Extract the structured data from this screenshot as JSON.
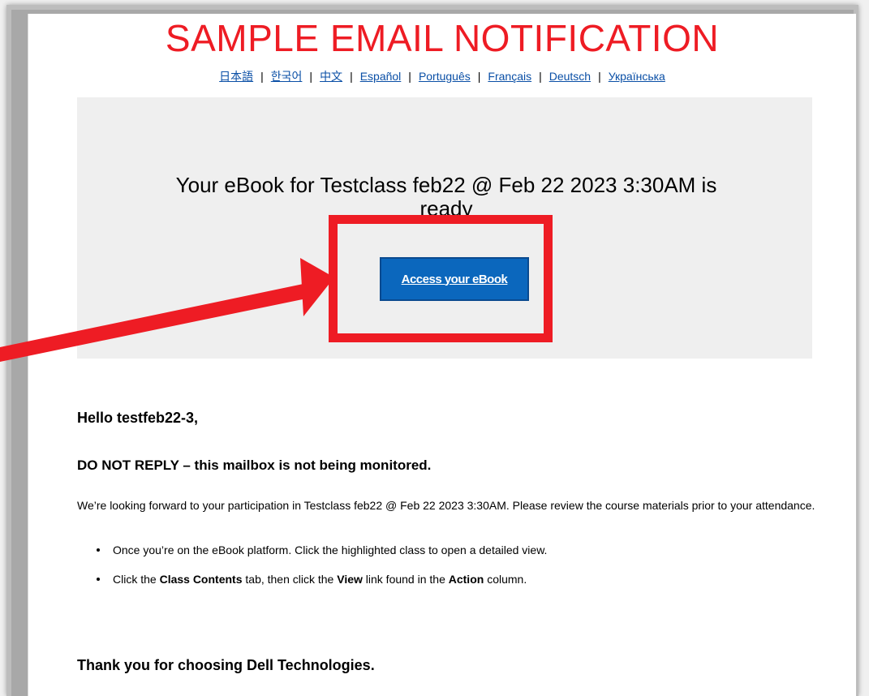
{
  "header": {
    "title": "SAMPLE EMAIL NOTIFICATION",
    "languages": [
      "日本語",
      "한국어",
      "中文",
      "Español",
      "Português",
      "Français",
      "Deutsch",
      "Українська"
    ]
  },
  "hero": {
    "message": "Your eBook for Testclass feb22 @ Feb 22 2023 3:30AM is ready",
    "button_label": "Access your eBook"
  },
  "body": {
    "greeting": "Hello testfeb22-3,",
    "no_reply": "DO NOT REPLY – this mailbox is not being monitored.",
    "intro": "We’re looking forward to your participation in Testclass feb22 @ Feb 22 2023 3:30AM. Please review the course materials prior to your attendance.",
    "bullet1": "Once you’re on the eBook platform. Click the highlighted class to open a detailed view.",
    "bullet2": {
      "part1": "Click the ",
      "bold1": "Class Contents",
      "part2": " tab, then click the ",
      "bold2": "View",
      "part3": " link found in the ",
      "bold3": "Action",
      "part4": " column."
    },
    "thanks": "Thank you for choosing Dell Technologies."
  },
  "colors": {
    "annotation_red": "#ee1c24",
    "button_blue": "#0b67bd",
    "link_blue": "#0a4fa6",
    "hero_bg": "#efefef"
  }
}
